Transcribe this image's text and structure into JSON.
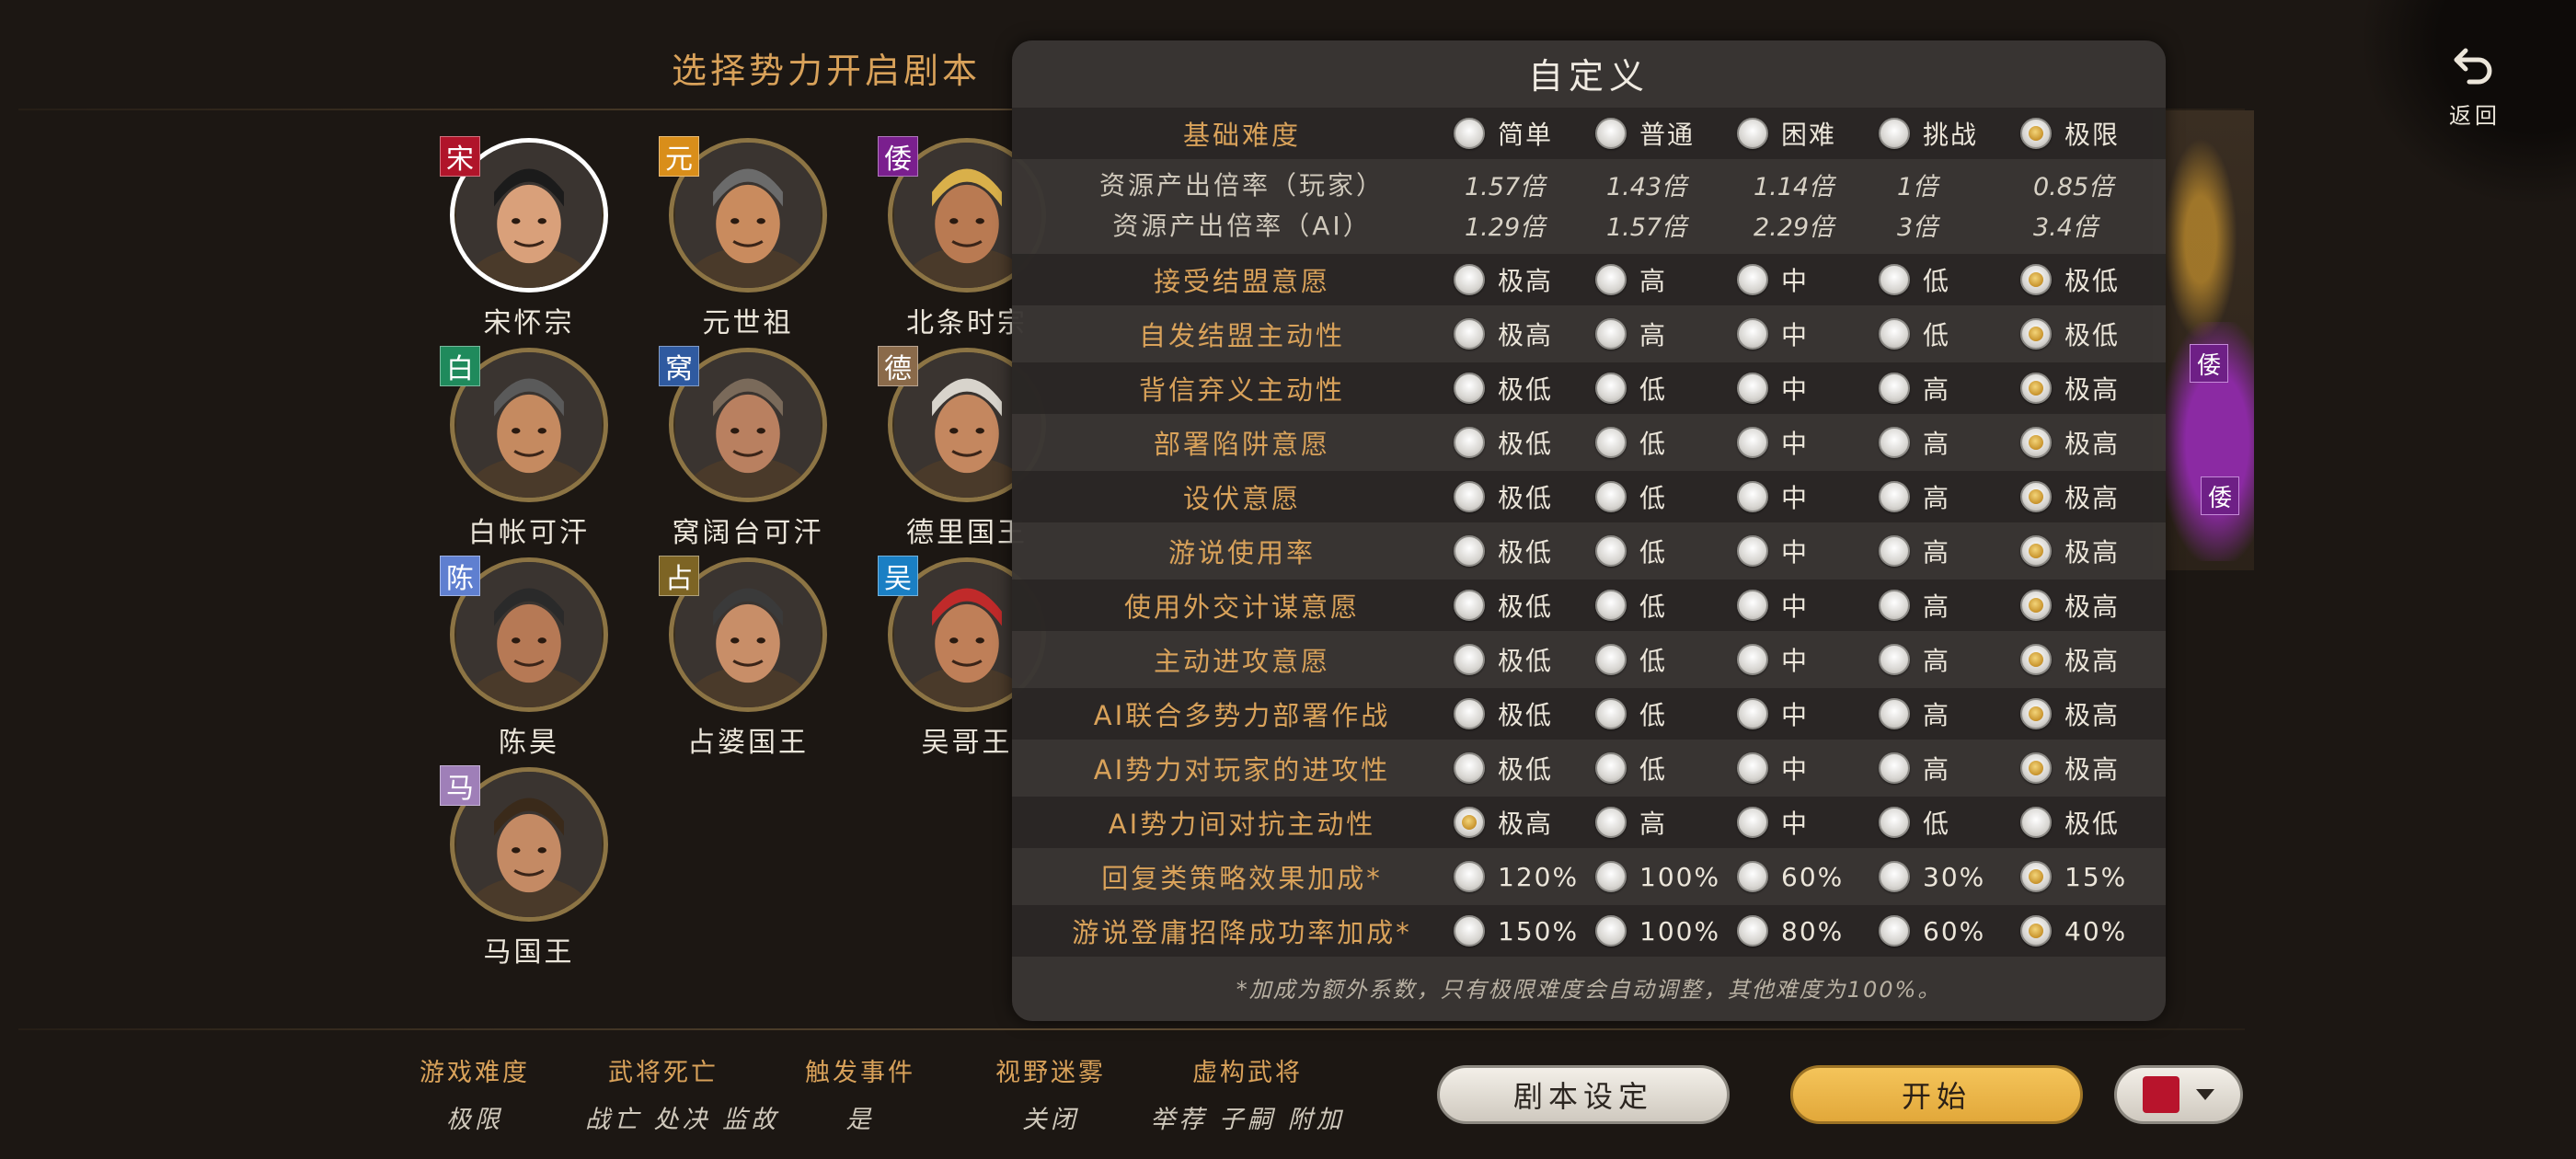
{
  "header": {
    "title": "选择势力开启剧本",
    "back_label": "返回",
    "back_icon": "undo-arrow-icon"
  },
  "map": {
    "labels": [
      "倭",
      "倭"
    ],
    "colors": {
      "yellow": "#b9882c",
      "purple": "#8b2aa3"
    }
  },
  "factions": [
    {
      "badge": "宋",
      "badge_color": "#b0142a",
      "name": "宋怀宗",
      "selected": true
    },
    {
      "badge": "元",
      "badge_color": "#d98e1a",
      "name": "元世祖",
      "selected": false
    },
    {
      "badge": "倭",
      "badge_color": "#7a1f8e",
      "name": "北条时宗",
      "selected": false
    },
    {
      "badge": "白",
      "badge_color": "#1f8a5c",
      "name": "白帐可汗",
      "selected": false
    },
    {
      "badge": "窝",
      "badge_color": "#2f5aa0",
      "name": "窝阔台可汗",
      "selected": false
    },
    {
      "badge": "德",
      "badge_color": "#8a6a4a",
      "name": "德里国王",
      "selected": false
    },
    {
      "badge": "陈",
      "badge_color": "#5f7fd0",
      "name": "陈昊",
      "selected": false
    },
    {
      "badge": "占",
      "badge_color": "#7d6424",
      "name": "占婆国王",
      "selected": false
    },
    {
      "badge": "吴",
      "badge_color": "#1a7fc4",
      "name": "吴哥王",
      "selected": false
    },
    {
      "badge": "马",
      "badge_color": "#9f7fb8",
      "name": "马国王",
      "selected": false
    }
  ],
  "modal": {
    "title": "自定义",
    "difficulty": {
      "label": "基础难度",
      "options": [
        "简单",
        "普通",
        "困难",
        "挑战",
        "极限"
      ],
      "selected": 4
    },
    "rates": [
      {
        "label": "资源产出倍率（玩家）",
        "values": [
          "1.57倍",
          "1.43倍",
          "1.14倍",
          "1倍",
          "0.85倍"
        ]
      },
      {
        "label": "资源产出倍率（AI）",
        "values": [
          "1.29倍",
          "1.57倍",
          "2.29倍",
          "3倍",
          "3.4倍"
        ]
      }
    ],
    "settings": [
      {
        "label": "接受结盟意愿",
        "options": [
          "极高",
          "高",
          "中",
          "低",
          "极低"
        ],
        "selected": 4
      },
      {
        "label": "自发结盟主动性",
        "options": [
          "极高",
          "高",
          "中",
          "低",
          "极低"
        ],
        "selected": 4
      },
      {
        "label": "背信弃义主动性",
        "options": [
          "极低",
          "低",
          "中",
          "高",
          "极高"
        ],
        "selected": 4
      },
      {
        "label": "部署陷阱意愿",
        "options": [
          "极低",
          "低",
          "中",
          "高",
          "极高"
        ],
        "selected": 4
      },
      {
        "label": "设伏意愿",
        "options": [
          "极低",
          "低",
          "中",
          "高",
          "极高"
        ],
        "selected": 4
      },
      {
        "label": "游说使用率",
        "options": [
          "极低",
          "低",
          "中",
          "高",
          "极高"
        ],
        "selected": 4
      },
      {
        "label": "使用外交计谋意愿",
        "options": [
          "极低",
          "低",
          "中",
          "高",
          "极高"
        ],
        "selected": 4
      },
      {
        "label": "主动进攻意愿",
        "options": [
          "极低",
          "低",
          "中",
          "高",
          "极高"
        ],
        "selected": 4
      },
      {
        "label": "AI联合多势力部署作战",
        "options": [
          "极低",
          "低",
          "中",
          "高",
          "极高"
        ],
        "selected": 4
      },
      {
        "label": "AI势力对玩家的进攻性",
        "options": [
          "极低",
          "低",
          "中",
          "高",
          "极高"
        ],
        "selected": 4
      },
      {
        "label": "AI势力间对抗主动性",
        "options": [
          "极高",
          "高",
          "中",
          "低",
          "极低"
        ],
        "selected": 0
      },
      {
        "label": "回复类策略效果加成*",
        "options": [
          "120%",
          "100%",
          "60%",
          "30%",
          "15%"
        ],
        "selected": 4
      },
      {
        "label": "游说登庸招降成功率加成*",
        "options": [
          "150%",
          "100%",
          "80%",
          "60%",
          "40%"
        ],
        "selected": 4
      }
    ],
    "note": "*加成为额外系数，只有极限难度会自动调整，其他难度为100%。"
  },
  "summary": [
    {
      "head": "游戏难度",
      "value": "极限"
    },
    {
      "head": "武将死亡",
      "value": "战亡 处决 监故"
    },
    {
      "head": "触发事件",
      "value": "是"
    },
    {
      "head": "视野迷雾",
      "value": "关闭"
    },
    {
      "head": "虚构武将",
      "value": "举荐 子嗣 附加"
    }
  ],
  "buttons": {
    "scenario": "剧本设定",
    "start": "开始",
    "color": "#b8142c"
  }
}
